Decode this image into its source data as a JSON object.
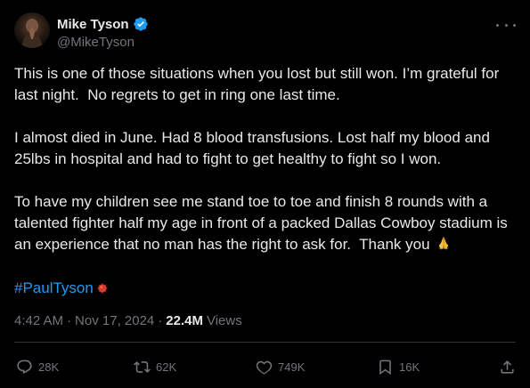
{
  "author": {
    "display_name": "Mike Tyson",
    "handle": "@MikeTyson",
    "verified": true
  },
  "tweet": {
    "paragraphs": [
      "This is one of those situations when you lost but still won. I’m grateful for last night.  No regrets to get in ring one last time.",
      "I almost died in June. Had 8 blood transfusions. Lost half my blood and 25lbs in hospital and had to fight to get healthy to fight so I won.",
      "To have my children see me stand toe to toe and finish 8 rounds with a talented fighter half my age in front of a packed Dallas Cowboy stadium is an experience that no man has the right to ask for.  Thank you"
    ],
    "hashtag": "#PaulTyson",
    "emoji": [
      "folded-hands",
      "anger-symbol"
    ]
  },
  "meta": {
    "time": "4:42 AM",
    "separator": "·",
    "date": "Nov 17, 2024",
    "views_count": "22.4M",
    "views_label": "Views"
  },
  "actions": {
    "replies": "28K",
    "reposts": "62K",
    "likes": "749K",
    "bookmarks": "16K"
  },
  "colors": {
    "background": "#000000",
    "text": "#e7e9ea",
    "secondary": "#71767b",
    "accent": "#1d9bf0",
    "divider": "#2f3336"
  },
  "icons": [
    "verified-badge-icon",
    "more-icon",
    "reply-icon",
    "repost-icon",
    "like-icon",
    "bookmark-icon",
    "share-icon"
  ]
}
